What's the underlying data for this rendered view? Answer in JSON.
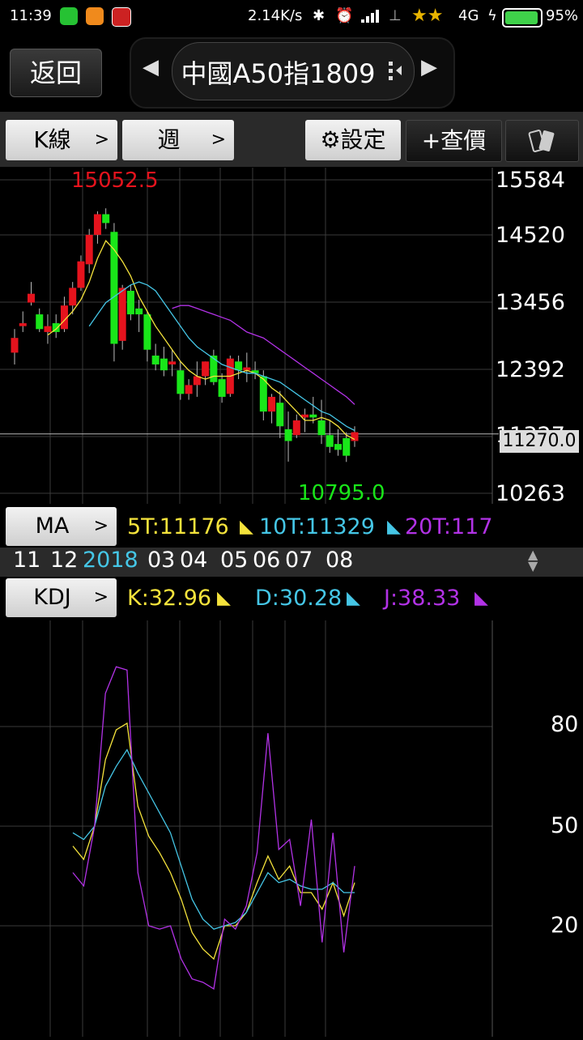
{
  "status_bar": {
    "time": "11:39",
    "net_speed": "2.14K/s",
    "network": "4G",
    "battery": "95%"
  },
  "nav": {
    "back_label": "返回",
    "title": "中國A50指1809"
  },
  "toolbar": {
    "kline_label": "K線",
    "period_label": "週",
    "settings_label": "設定",
    "quote_label": "+查價"
  },
  "kline": {
    "high_label": "15052.5",
    "low_label": "10795.0",
    "price_tag": "11270.0",
    "y_ticks": [
      "15584",
      "14520",
      "13456",
      "12392",
      "11327",
      "10263"
    ]
  },
  "ma_bar": {
    "button_label": "MA",
    "ma5": "5T:11176",
    "ma10": "10T:11329",
    "ma20": "20T:117"
  },
  "date_axis": {
    "labels": [
      "11",
      "12",
      "2018",
      "03",
      "04",
      "05",
      "06",
      "07",
      "08"
    ]
  },
  "kdj_bar": {
    "button_label": "KDJ",
    "k": "K:32.96",
    "d": "D:30.28",
    "j": "J:38.33"
  },
  "kdj_axis": {
    "ticks": [
      "80",
      "50",
      "20"
    ]
  },
  "colors": {
    "up": "#e5131d",
    "down": "#19e619",
    "ma5": "#f5e33c",
    "ma10": "#45c6e6",
    "ma20": "#b232e6",
    "grid": "#3a3a3a"
  },
  "chart_data": [
    {
      "type": "candlestick",
      "title": "中國A50指1809",
      "ylim": [
        10263,
        15584
      ],
      "x_labels": [
        "11",
        "12",
        "2018",
        "03",
        "04",
        "05",
        "06",
        "07",
        "08"
      ],
      "ohlc": [
        [
          12650,
          13050,
          12450,
          12900
        ],
        [
          13100,
          13350,
          13000,
          13150
        ],
        [
          13500,
          13850,
          13450,
          13650
        ],
        [
          13300,
          13400,
          13000,
          13050
        ],
        [
          13000,
          13300,
          12800,
          13100
        ],
        [
          13150,
          13300,
          12900,
          13000
        ],
        [
          13050,
          13600,
          13000,
          13450
        ],
        [
          13450,
          13850,
          13300,
          13750
        ],
        [
          13750,
          14300,
          13700,
          14200
        ],
        [
          14150,
          14750,
          14000,
          14650
        ],
        [
          14650,
          15050,
          14500,
          15000
        ],
        [
          15000,
          15100,
          14750,
          14850
        ],
        [
          14700,
          14850,
          12500,
          12800
        ],
        [
          12850,
          13800,
          12700,
          13750
        ],
        [
          13700,
          13800,
          13200,
          13300
        ],
        [
          13400,
          13550,
          13000,
          13300
        ],
        [
          13300,
          13350,
          12500,
          12700
        ],
        [
          12600,
          12800,
          12350,
          12450
        ],
        [
          12550,
          12750,
          12250,
          12350
        ],
        [
          12450,
          12700,
          12250,
          12500
        ],
        [
          12350,
          12500,
          11850,
          11950
        ],
        [
          11950,
          12200,
          11850,
          12100
        ],
        [
          12100,
          12500,
          11900,
          12250
        ],
        [
          12250,
          12500,
          12100,
          12500
        ],
        [
          12600,
          12700,
          12100,
          12150
        ],
        [
          12200,
          12300,
          11800,
          11900
        ],
        [
          11950,
          12600,
          11900,
          12550
        ],
        [
          12500,
          12600,
          12200,
          12350
        ],
        [
          12350,
          12650,
          12150,
          12400
        ],
        [
          12350,
          12500,
          12200,
          12300
        ],
        [
          12250,
          12350,
          11500,
          11650
        ],
        [
          11650,
          11950,
          11450,
          11900
        ],
        [
          11800,
          12000,
          11200,
          11400
        ],
        [
          11350,
          11650,
          10800,
          11150
        ],
        [
          11250,
          11600,
          11200,
          11500
        ],
        [
          11550,
          11700,
          11300,
          11600
        ],
        [
          11600,
          11900,
          11450,
          11550
        ],
        [
          11500,
          11850,
          11100,
          11250
        ],
        [
          11250,
          11500,
          10950,
          11050
        ],
        [
          11100,
          11350,
          10900,
          11000
        ],
        [
          11200,
          11300,
          10795,
          10900
        ],
        [
          11150,
          11400,
          11050,
          11300
        ]
      ],
      "series": [
        {
          "name": "5T",
          "values": [
            null,
            null,
            null,
            null,
            12950,
            13050,
            13200,
            13350,
            13550,
            13850,
            14250,
            14550,
            14400,
            14200,
            13950,
            13600,
            13350,
            13100,
            12900,
            12700,
            12500,
            12350,
            12250,
            12200,
            12250,
            12250,
            12250,
            12300,
            12350,
            12300,
            12200,
            12050,
            11950,
            11800,
            11650,
            11500,
            11500,
            11550,
            11500,
            11400,
            11250,
            11176
          ]
        },
        {
          "name": "10T",
          "values": [
            null,
            null,
            null,
            null,
            null,
            null,
            null,
            null,
            null,
            13100,
            13300,
            13500,
            13600,
            13700,
            13800,
            13850,
            13800,
            13700,
            13500,
            13300,
            13100,
            12900,
            12750,
            12650,
            12550,
            12450,
            12400,
            12350,
            12300,
            12300,
            12250,
            12200,
            12150,
            12050,
            11950,
            11850,
            11750,
            11650,
            11600,
            11500,
            11400,
            11329
          ]
        },
        {
          "name": "20T",
          "values": [
            null,
            null,
            null,
            null,
            null,
            null,
            null,
            null,
            null,
            null,
            null,
            null,
            null,
            null,
            null,
            null,
            null,
            null,
            null,
            13400,
            13450,
            13450,
            13400,
            13350,
            13300,
            13250,
            13200,
            13100,
            13000,
            12950,
            12900,
            12800,
            12700,
            12600,
            12500,
            12400,
            12300,
            12200,
            12100,
            12000,
            11900,
            11770
          ]
        }
      ]
    },
    {
      "type": "line",
      "title": "KDJ",
      "ylim": [
        0,
        100
      ],
      "y_ticks": [
        80,
        50,
        20
      ],
      "series": [
        {
          "name": "K",
          "values": [
            44,
            40,
            50,
            70,
            79,
            81,
            56,
            47,
            42,
            36,
            28,
            18,
            13,
            10,
            20,
            20,
            24,
            33,
            41,
            34,
            38,
            30,
            30,
            25,
            33,
            23,
            33
          ]
        },
        {
          "name": "D",
          "values": [
            48,
            46,
            50,
            62,
            68,
            73,
            66,
            60,
            54,
            48,
            38,
            28,
            22,
            19,
            20,
            21,
            24,
            30,
            36,
            33,
            34,
            32,
            31,
            31,
            33,
            30,
            30
          ]
        },
        {
          "name": "J",
          "values": [
            36,
            32,
            50,
            90,
            98,
            97,
            36,
            20,
            19,
            20,
            10,
            4,
            3,
            1,
            22,
            19,
            26,
            42,
            78,
            43,
            46,
            26,
            52,
            15,
            48,
            12,
            38
          ]
        }
      ]
    }
  ]
}
